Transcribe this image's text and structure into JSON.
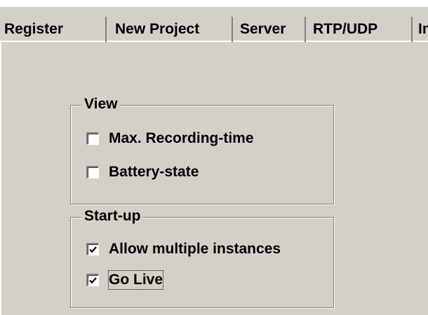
{
  "tabs": [
    {
      "label": "Register"
    },
    {
      "label": "New Project"
    },
    {
      "label": "Server"
    },
    {
      "label": "RTP/UDP"
    },
    {
      "label": "In"
    }
  ],
  "view_group": {
    "title": "View",
    "items": [
      {
        "label": "Max. Recording-time",
        "checked": false
      },
      {
        "label": "Battery-state",
        "checked": false
      }
    ]
  },
  "startup_group": {
    "title": "Start-up",
    "items": [
      {
        "label": "Allow multiple instances",
        "checked": true
      },
      {
        "label": "Go Live",
        "checked": true,
        "focused": true
      }
    ]
  }
}
